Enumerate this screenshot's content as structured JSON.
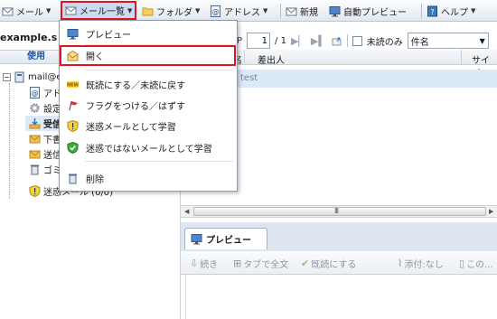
{
  "toolbar": {
    "mail_label": "メール",
    "mail_list_label": "メール一覧",
    "folder_label": "フォルダ",
    "address_label": "アドレス",
    "new_label": "新規",
    "auto_preview_label": "自動プレビュー",
    "help_label": "ヘルプ"
  },
  "menu": {
    "items": [
      {
        "label": "プレビュー",
        "icon": "monitor-icon"
      },
      {
        "label": "開く",
        "icon": "envelope-open-icon"
      },
      {
        "label": "既読にする／未読に戻す",
        "icon": "new-badge-icon"
      },
      {
        "label": "フラグをつける／はずす",
        "icon": "flag-icon"
      },
      {
        "label": "迷惑メールとして学習",
        "icon": "shield-warning-icon"
      },
      {
        "label": "迷惑ではないメールとして学習",
        "icon": "shield-check-icon"
      },
      {
        "label": "削除",
        "icon": "trash-icon"
      }
    ]
  },
  "left_panel": {
    "title": "example.s",
    "header": "使用",
    "tree": [
      {
        "label": "mail@e"
      },
      {
        "label": "アド"
      },
      {
        "label": "設定"
      },
      {
        "label": "受信"
      },
      {
        "label": "下書"
      },
      {
        "label": "送信"
      },
      {
        "label": "ゴミ"
      },
      {
        "label": "迷惑メール (0/0)"
      }
    ]
  },
  "list": {
    "page_value": "1",
    "page_total": "/ 1",
    "unread_only_label": "未読のみ",
    "search_field": "件名",
    "columns": {
      "subject": "名",
      "sender": "差出人",
      "size": "サイズ"
    },
    "rows": [
      {
        "subject": "test"
      }
    ],
    "scroll_grip": "III"
  },
  "preview": {
    "tab_label": "プレビュー",
    "toolbar": {
      "continue_label": "続き",
      "tab_fulltext_label": "タブで全文",
      "mark_read_label": "既読にする",
      "attach_label": "添付:なし",
      "this_label": "この..."
    }
  },
  "colors": {
    "highlight": "#e0141e",
    "selected_row": "#dce9f8",
    "accent": "#1a54a8"
  }
}
